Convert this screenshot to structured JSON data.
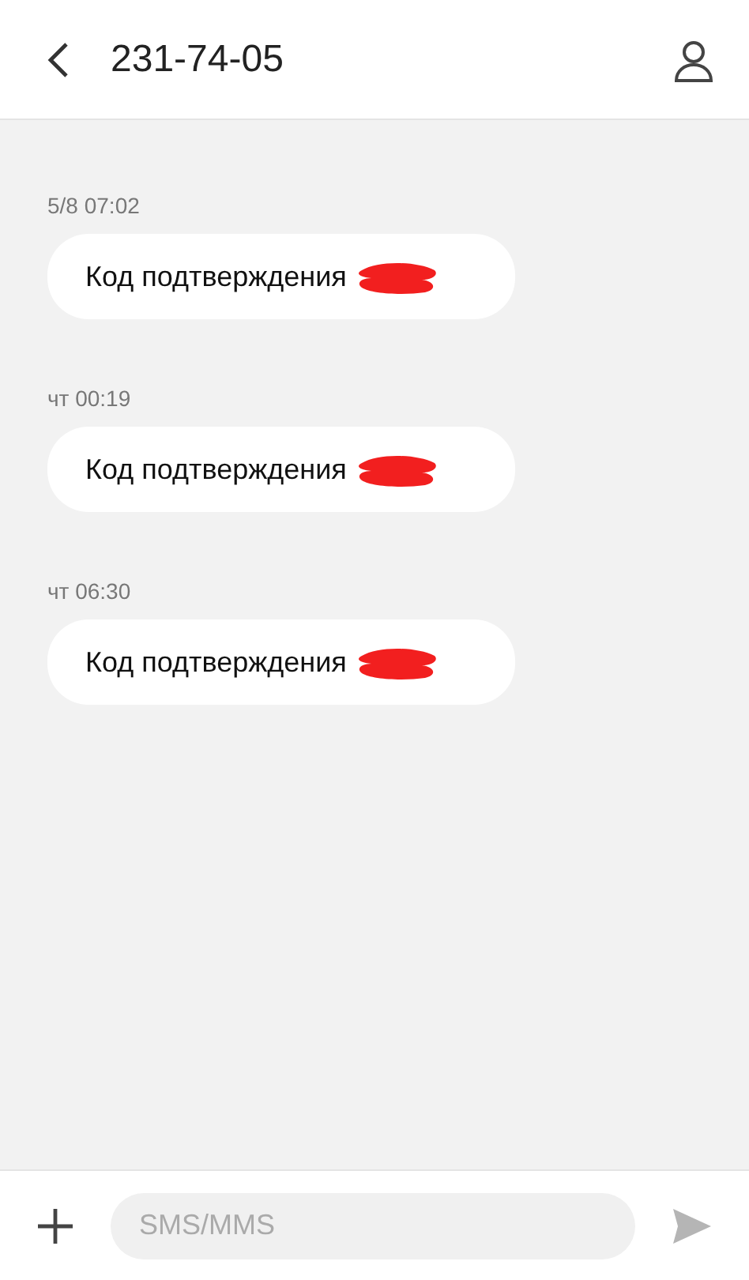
{
  "header": {
    "title": "231-74-05"
  },
  "messages": [
    {
      "time": "5/8 07:02",
      "text": "Код подтверждения",
      "redacted": true
    },
    {
      "time": "чт 00:19",
      "text": "Код подтверждения",
      "redacted": true
    },
    {
      "time": "чт 06:30",
      "text": "Код подтверждения",
      "redacted": true
    }
  ],
  "composer": {
    "placeholder": "SMS/MMS"
  }
}
